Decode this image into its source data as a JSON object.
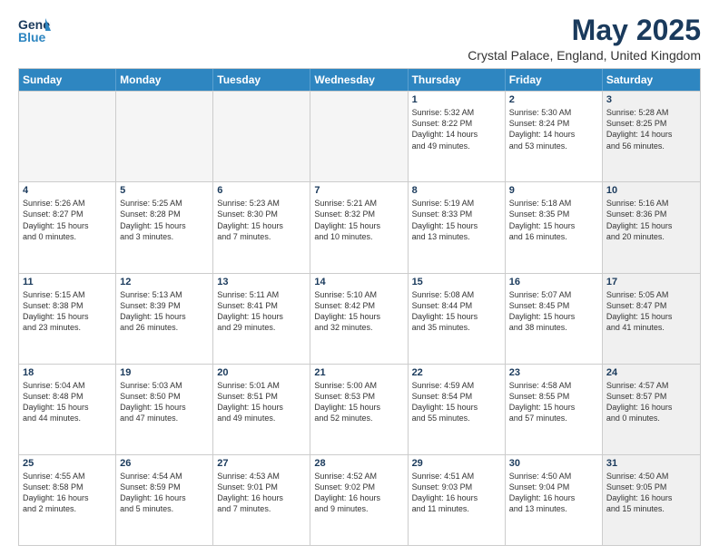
{
  "logo": {
    "general": "General",
    "blue": "Blue"
  },
  "title": "May 2025",
  "location": "Crystal Palace, England, United Kingdom",
  "header": {
    "days": [
      "Sunday",
      "Monday",
      "Tuesday",
      "Wednesday",
      "Thursday",
      "Friday",
      "Saturday"
    ]
  },
  "weeks": [
    [
      {
        "day": "",
        "info": "",
        "empty": true
      },
      {
        "day": "",
        "info": "",
        "empty": true
      },
      {
        "day": "",
        "info": "",
        "empty": true
      },
      {
        "day": "",
        "info": "",
        "empty": true
      },
      {
        "day": "1",
        "info": "Sunrise: 5:32 AM\nSunset: 8:22 PM\nDaylight: 14 hours\nand 49 minutes."
      },
      {
        "day": "2",
        "info": "Sunrise: 5:30 AM\nSunset: 8:24 PM\nDaylight: 14 hours\nand 53 minutes."
      },
      {
        "day": "3",
        "info": "Sunrise: 5:28 AM\nSunset: 8:25 PM\nDaylight: 14 hours\nand 56 minutes.",
        "shaded": true
      }
    ],
    [
      {
        "day": "4",
        "info": "Sunrise: 5:26 AM\nSunset: 8:27 PM\nDaylight: 15 hours\nand 0 minutes."
      },
      {
        "day": "5",
        "info": "Sunrise: 5:25 AM\nSunset: 8:28 PM\nDaylight: 15 hours\nand 3 minutes."
      },
      {
        "day": "6",
        "info": "Sunrise: 5:23 AM\nSunset: 8:30 PM\nDaylight: 15 hours\nand 7 minutes."
      },
      {
        "day": "7",
        "info": "Sunrise: 5:21 AM\nSunset: 8:32 PM\nDaylight: 15 hours\nand 10 minutes."
      },
      {
        "day": "8",
        "info": "Sunrise: 5:19 AM\nSunset: 8:33 PM\nDaylight: 15 hours\nand 13 minutes."
      },
      {
        "day": "9",
        "info": "Sunrise: 5:18 AM\nSunset: 8:35 PM\nDaylight: 15 hours\nand 16 minutes."
      },
      {
        "day": "10",
        "info": "Sunrise: 5:16 AM\nSunset: 8:36 PM\nDaylight: 15 hours\nand 20 minutes.",
        "shaded": true
      }
    ],
    [
      {
        "day": "11",
        "info": "Sunrise: 5:15 AM\nSunset: 8:38 PM\nDaylight: 15 hours\nand 23 minutes."
      },
      {
        "day": "12",
        "info": "Sunrise: 5:13 AM\nSunset: 8:39 PM\nDaylight: 15 hours\nand 26 minutes."
      },
      {
        "day": "13",
        "info": "Sunrise: 5:11 AM\nSunset: 8:41 PM\nDaylight: 15 hours\nand 29 minutes."
      },
      {
        "day": "14",
        "info": "Sunrise: 5:10 AM\nSunset: 8:42 PM\nDaylight: 15 hours\nand 32 minutes."
      },
      {
        "day": "15",
        "info": "Sunrise: 5:08 AM\nSunset: 8:44 PM\nDaylight: 15 hours\nand 35 minutes."
      },
      {
        "day": "16",
        "info": "Sunrise: 5:07 AM\nSunset: 8:45 PM\nDaylight: 15 hours\nand 38 minutes."
      },
      {
        "day": "17",
        "info": "Sunrise: 5:05 AM\nSunset: 8:47 PM\nDaylight: 15 hours\nand 41 minutes.",
        "shaded": true
      }
    ],
    [
      {
        "day": "18",
        "info": "Sunrise: 5:04 AM\nSunset: 8:48 PM\nDaylight: 15 hours\nand 44 minutes."
      },
      {
        "day": "19",
        "info": "Sunrise: 5:03 AM\nSunset: 8:50 PM\nDaylight: 15 hours\nand 47 minutes."
      },
      {
        "day": "20",
        "info": "Sunrise: 5:01 AM\nSunset: 8:51 PM\nDaylight: 15 hours\nand 49 minutes."
      },
      {
        "day": "21",
        "info": "Sunrise: 5:00 AM\nSunset: 8:53 PM\nDaylight: 15 hours\nand 52 minutes."
      },
      {
        "day": "22",
        "info": "Sunrise: 4:59 AM\nSunset: 8:54 PM\nDaylight: 15 hours\nand 55 minutes."
      },
      {
        "day": "23",
        "info": "Sunrise: 4:58 AM\nSunset: 8:55 PM\nDaylight: 15 hours\nand 57 minutes."
      },
      {
        "day": "24",
        "info": "Sunrise: 4:57 AM\nSunset: 8:57 PM\nDaylight: 16 hours\nand 0 minutes.",
        "shaded": true
      }
    ],
    [
      {
        "day": "25",
        "info": "Sunrise: 4:55 AM\nSunset: 8:58 PM\nDaylight: 16 hours\nand 2 minutes."
      },
      {
        "day": "26",
        "info": "Sunrise: 4:54 AM\nSunset: 8:59 PM\nDaylight: 16 hours\nand 5 minutes."
      },
      {
        "day": "27",
        "info": "Sunrise: 4:53 AM\nSunset: 9:01 PM\nDaylight: 16 hours\nand 7 minutes."
      },
      {
        "day": "28",
        "info": "Sunrise: 4:52 AM\nSunset: 9:02 PM\nDaylight: 16 hours\nand 9 minutes."
      },
      {
        "day": "29",
        "info": "Sunrise: 4:51 AM\nSunset: 9:03 PM\nDaylight: 16 hours\nand 11 minutes."
      },
      {
        "day": "30",
        "info": "Sunrise: 4:50 AM\nSunset: 9:04 PM\nDaylight: 16 hours\nand 13 minutes."
      },
      {
        "day": "31",
        "info": "Sunrise: 4:50 AM\nSunset: 9:05 PM\nDaylight: 16 hours\nand 15 minutes.",
        "shaded": true
      }
    ]
  ]
}
